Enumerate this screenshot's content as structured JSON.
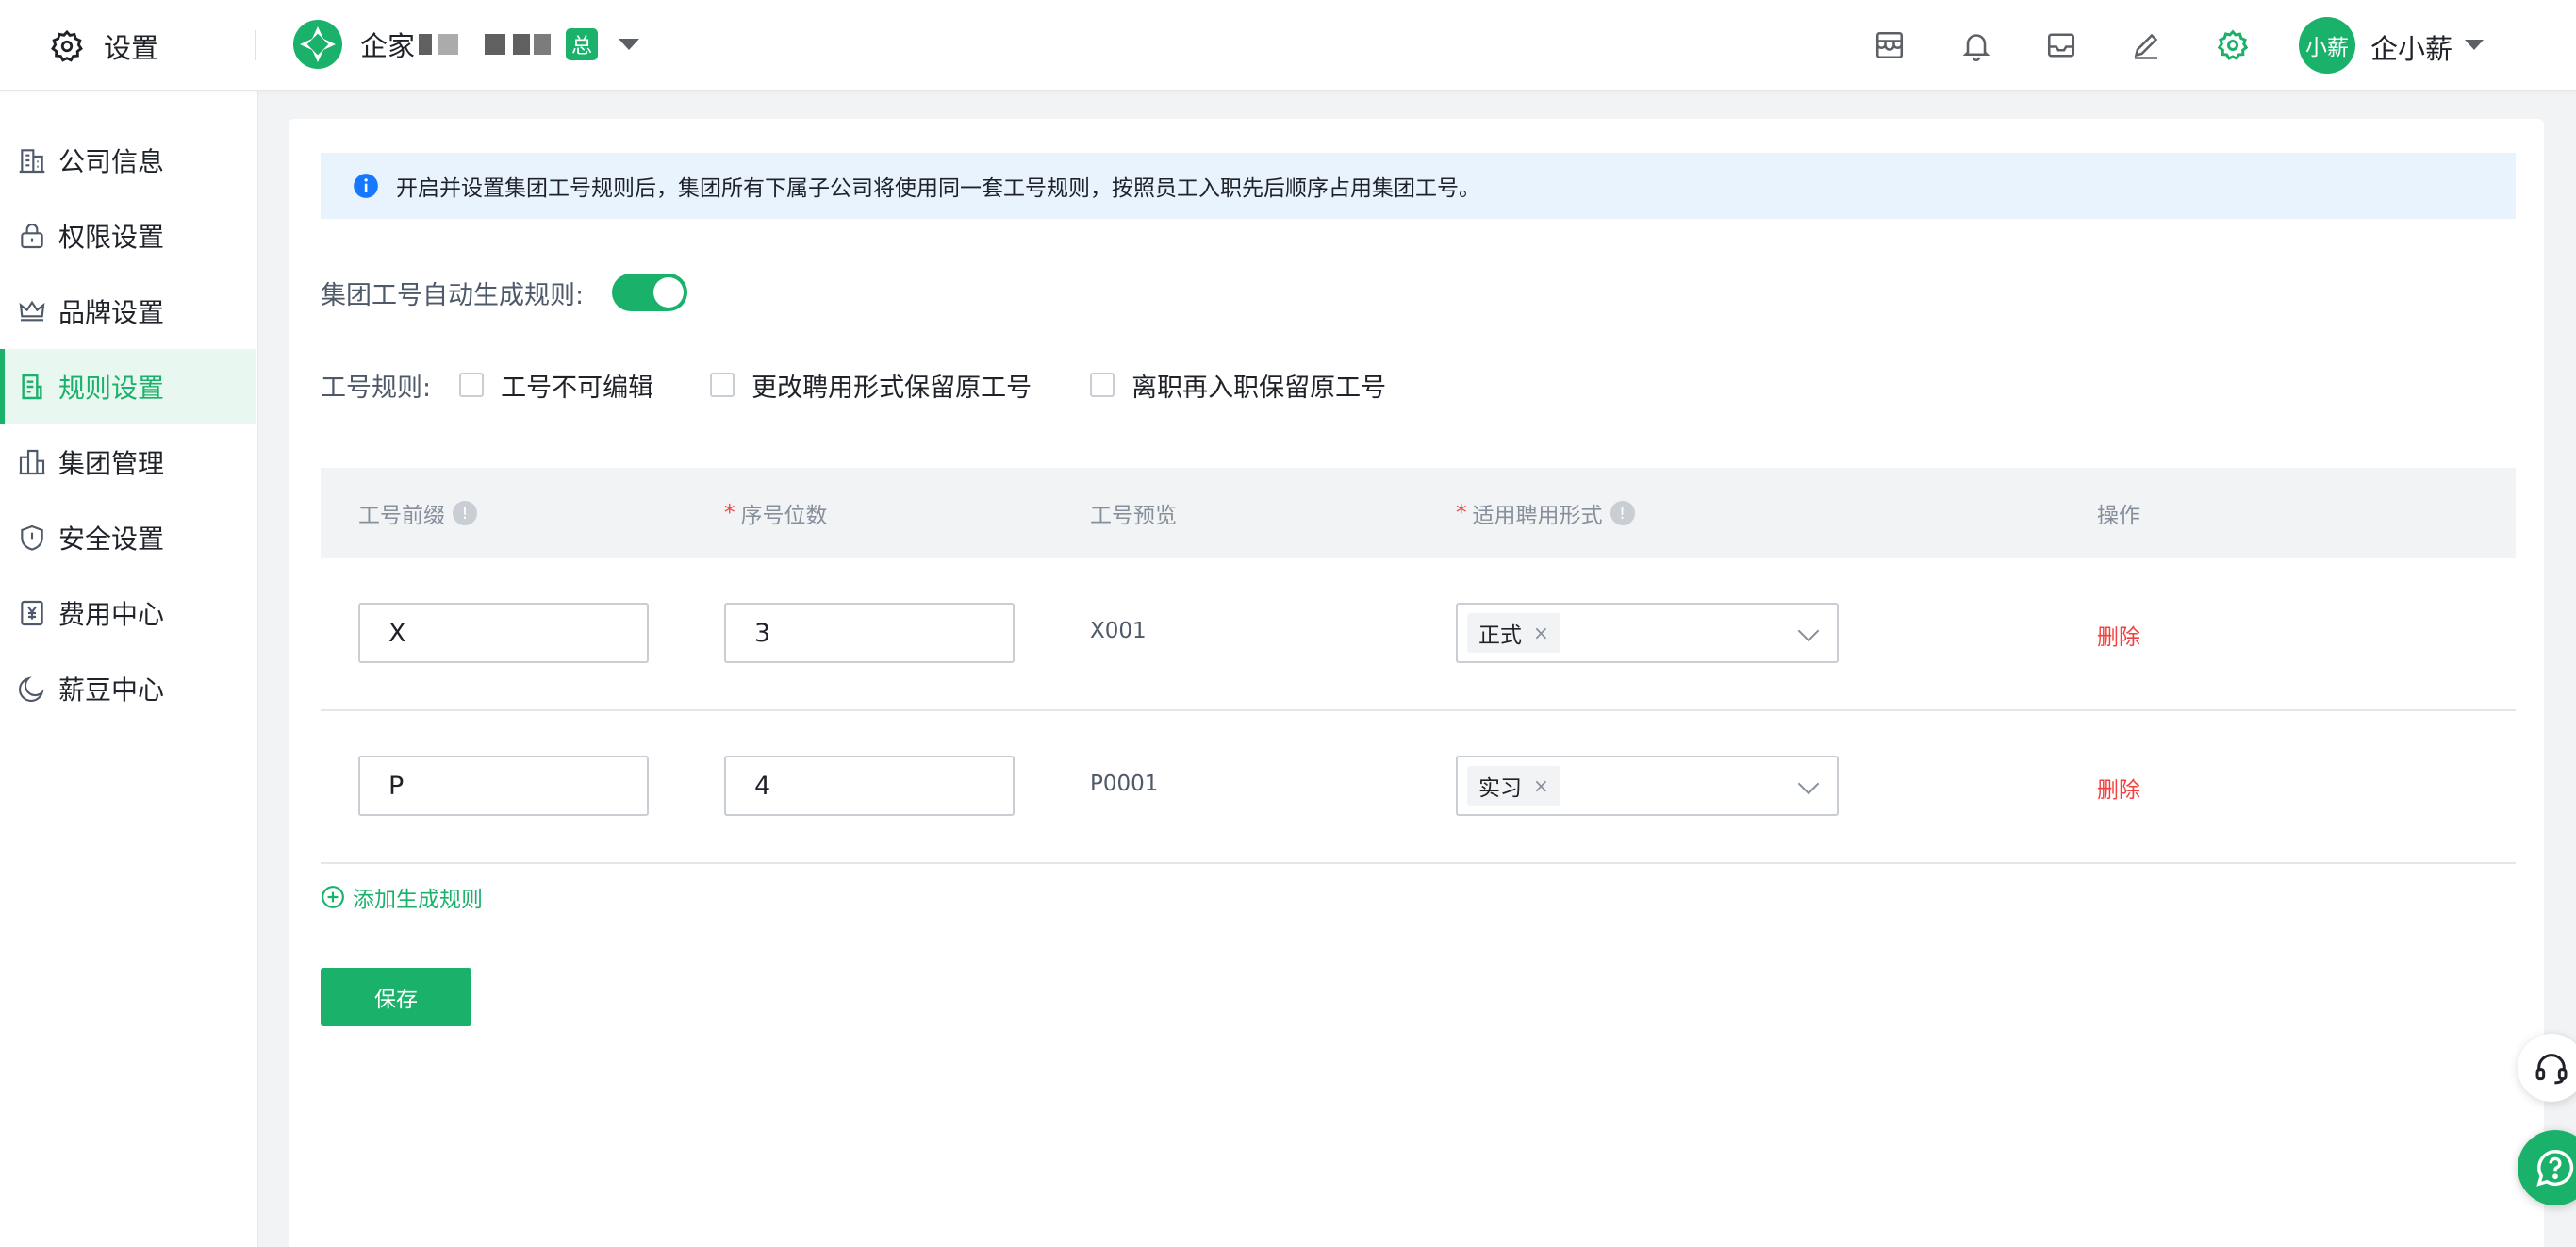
{
  "header": {
    "settings_label": "设置",
    "company_name": "企家",
    "company_badge": "总",
    "user_avatar_text": "小薪",
    "user_name": "企小薪"
  },
  "sidebar": {
    "items": [
      {
        "label": "公司信息",
        "icon": "building-icon"
      },
      {
        "label": "权限设置",
        "icon": "lock-icon"
      },
      {
        "label": "品牌设置",
        "icon": "crown-icon"
      },
      {
        "label": "规则设置",
        "icon": "document-icon",
        "active": true
      },
      {
        "label": "集团管理",
        "icon": "buildings-icon"
      },
      {
        "label": "安全设置",
        "icon": "shield-icon"
      },
      {
        "label": "费用中心",
        "icon": "yuan-icon"
      },
      {
        "label": "薪豆中心",
        "icon": "moon-icon"
      }
    ]
  },
  "main": {
    "notice": "开启并设置集团工号规则后，集团所有下属子公司将使用同一套工号规则，按照员工入职先后顺序占用集团工号。",
    "switch_label": "集团工号自动生成规则:",
    "switch_on": true,
    "rules_label": "工号规则:",
    "rule_options": [
      "工号不可编辑",
      "更改聘用形式保留原工号",
      "离职再入职保留原工号"
    ],
    "table": {
      "headers": {
        "prefix": "工号前缀",
        "digits": "序号位数",
        "preview": "工号预览",
        "employment": "适用聘用形式",
        "action": "操作",
        "required_mark": "*"
      },
      "rows": [
        {
          "prefix": "X",
          "digits": "3",
          "preview": "X001",
          "employment": "正式",
          "action": "删除"
        },
        {
          "prefix": "P",
          "digits": "4",
          "preview": "P0001",
          "employment": "实习",
          "action": "删除"
        }
      ]
    },
    "add_rule": "添加生成规则",
    "save": "保存"
  },
  "colors": {
    "brand": "#1ab26b",
    "danger": "#f53f3f",
    "notice_bg": "#e8f3fe"
  }
}
